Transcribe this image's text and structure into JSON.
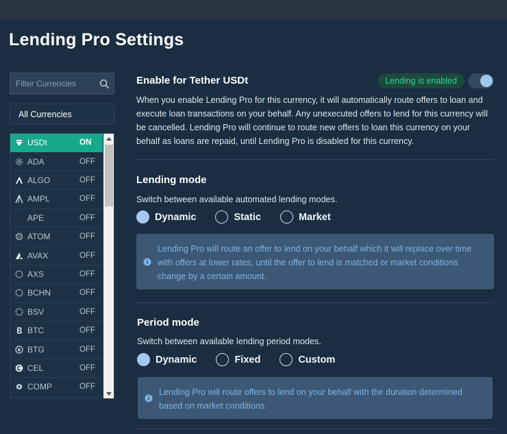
{
  "page": {
    "title": "Lending Pro Settings"
  },
  "sidebar": {
    "filter_placeholder": "Filter Currencies",
    "all_label": "All Currencies",
    "currencies": [
      {
        "name": "USDt",
        "status": "ON",
        "icon": "gem-icon"
      },
      {
        "name": "ADA",
        "status": "OFF",
        "icon": "ada-icon"
      },
      {
        "name": "ALGO",
        "status": "OFF",
        "icon": "algo-icon"
      },
      {
        "name": "AMPL",
        "status": "OFF",
        "icon": "ampl-icon"
      },
      {
        "name": "APE",
        "status": "OFF",
        "icon": ""
      },
      {
        "name": "ATOM",
        "status": "OFF",
        "icon": "atom-icon"
      },
      {
        "name": "AVAX",
        "status": "OFF",
        "icon": "avax-icon"
      },
      {
        "name": "AXS",
        "status": "OFF",
        "icon": "axs-icon"
      },
      {
        "name": "BCHN",
        "status": "OFF",
        "icon": "bchn-icon"
      },
      {
        "name": "BSV",
        "status": "OFF",
        "icon": "bsv-icon"
      },
      {
        "name": "BTC",
        "status": "OFF",
        "icon": "btc-icon"
      },
      {
        "name": "BTG",
        "status": "OFF",
        "icon": "btg-icon"
      },
      {
        "name": "CEL",
        "status": "OFF",
        "icon": "cel-icon"
      },
      {
        "name": "COMP",
        "status": "OFF",
        "icon": "comp-icon"
      }
    ]
  },
  "enable_section": {
    "title": "Enable for Tether USDt",
    "badge": "Lending is enabled",
    "toggle_on": true,
    "description": "When you enable Lending Pro for this currency, it will automatically route offers to loan and execute loan transactions on your behalf. Any unexecuted offers to lend for this currency will be cancelled. Lending Pro will continue to route new offers to loan this currency on your behalf as loans are repaid, until Lending Pro is disabled for this currency."
  },
  "lending_mode": {
    "title": "Lending mode",
    "subtitle": "Switch between available automated lending modes.",
    "options": [
      "Dynamic",
      "Static",
      "Market"
    ],
    "selected": "Dynamic",
    "info": "Lending Pro will route an offer to lend on your behalf which it will replace over time with offers at lower rates, until the offer to lend is matched or market conditions change by a certain amount."
  },
  "period_mode": {
    "title": "Period mode",
    "subtitle": "Switch between available lending period modes.",
    "options": [
      "Dynamic",
      "Fixed",
      "Custom"
    ],
    "selected": "Dynamic",
    "info": "Lending Pro will route offers to lend on your behalf with the duration determined based on market conditions."
  },
  "colors": {
    "background": "#1b2d40",
    "accent_green": "#17a98c",
    "badge_text": "#2fd29a",
    "info_text": "#7cb4ea",
    "radio_selected": "#a6c8f0"
  }
}
